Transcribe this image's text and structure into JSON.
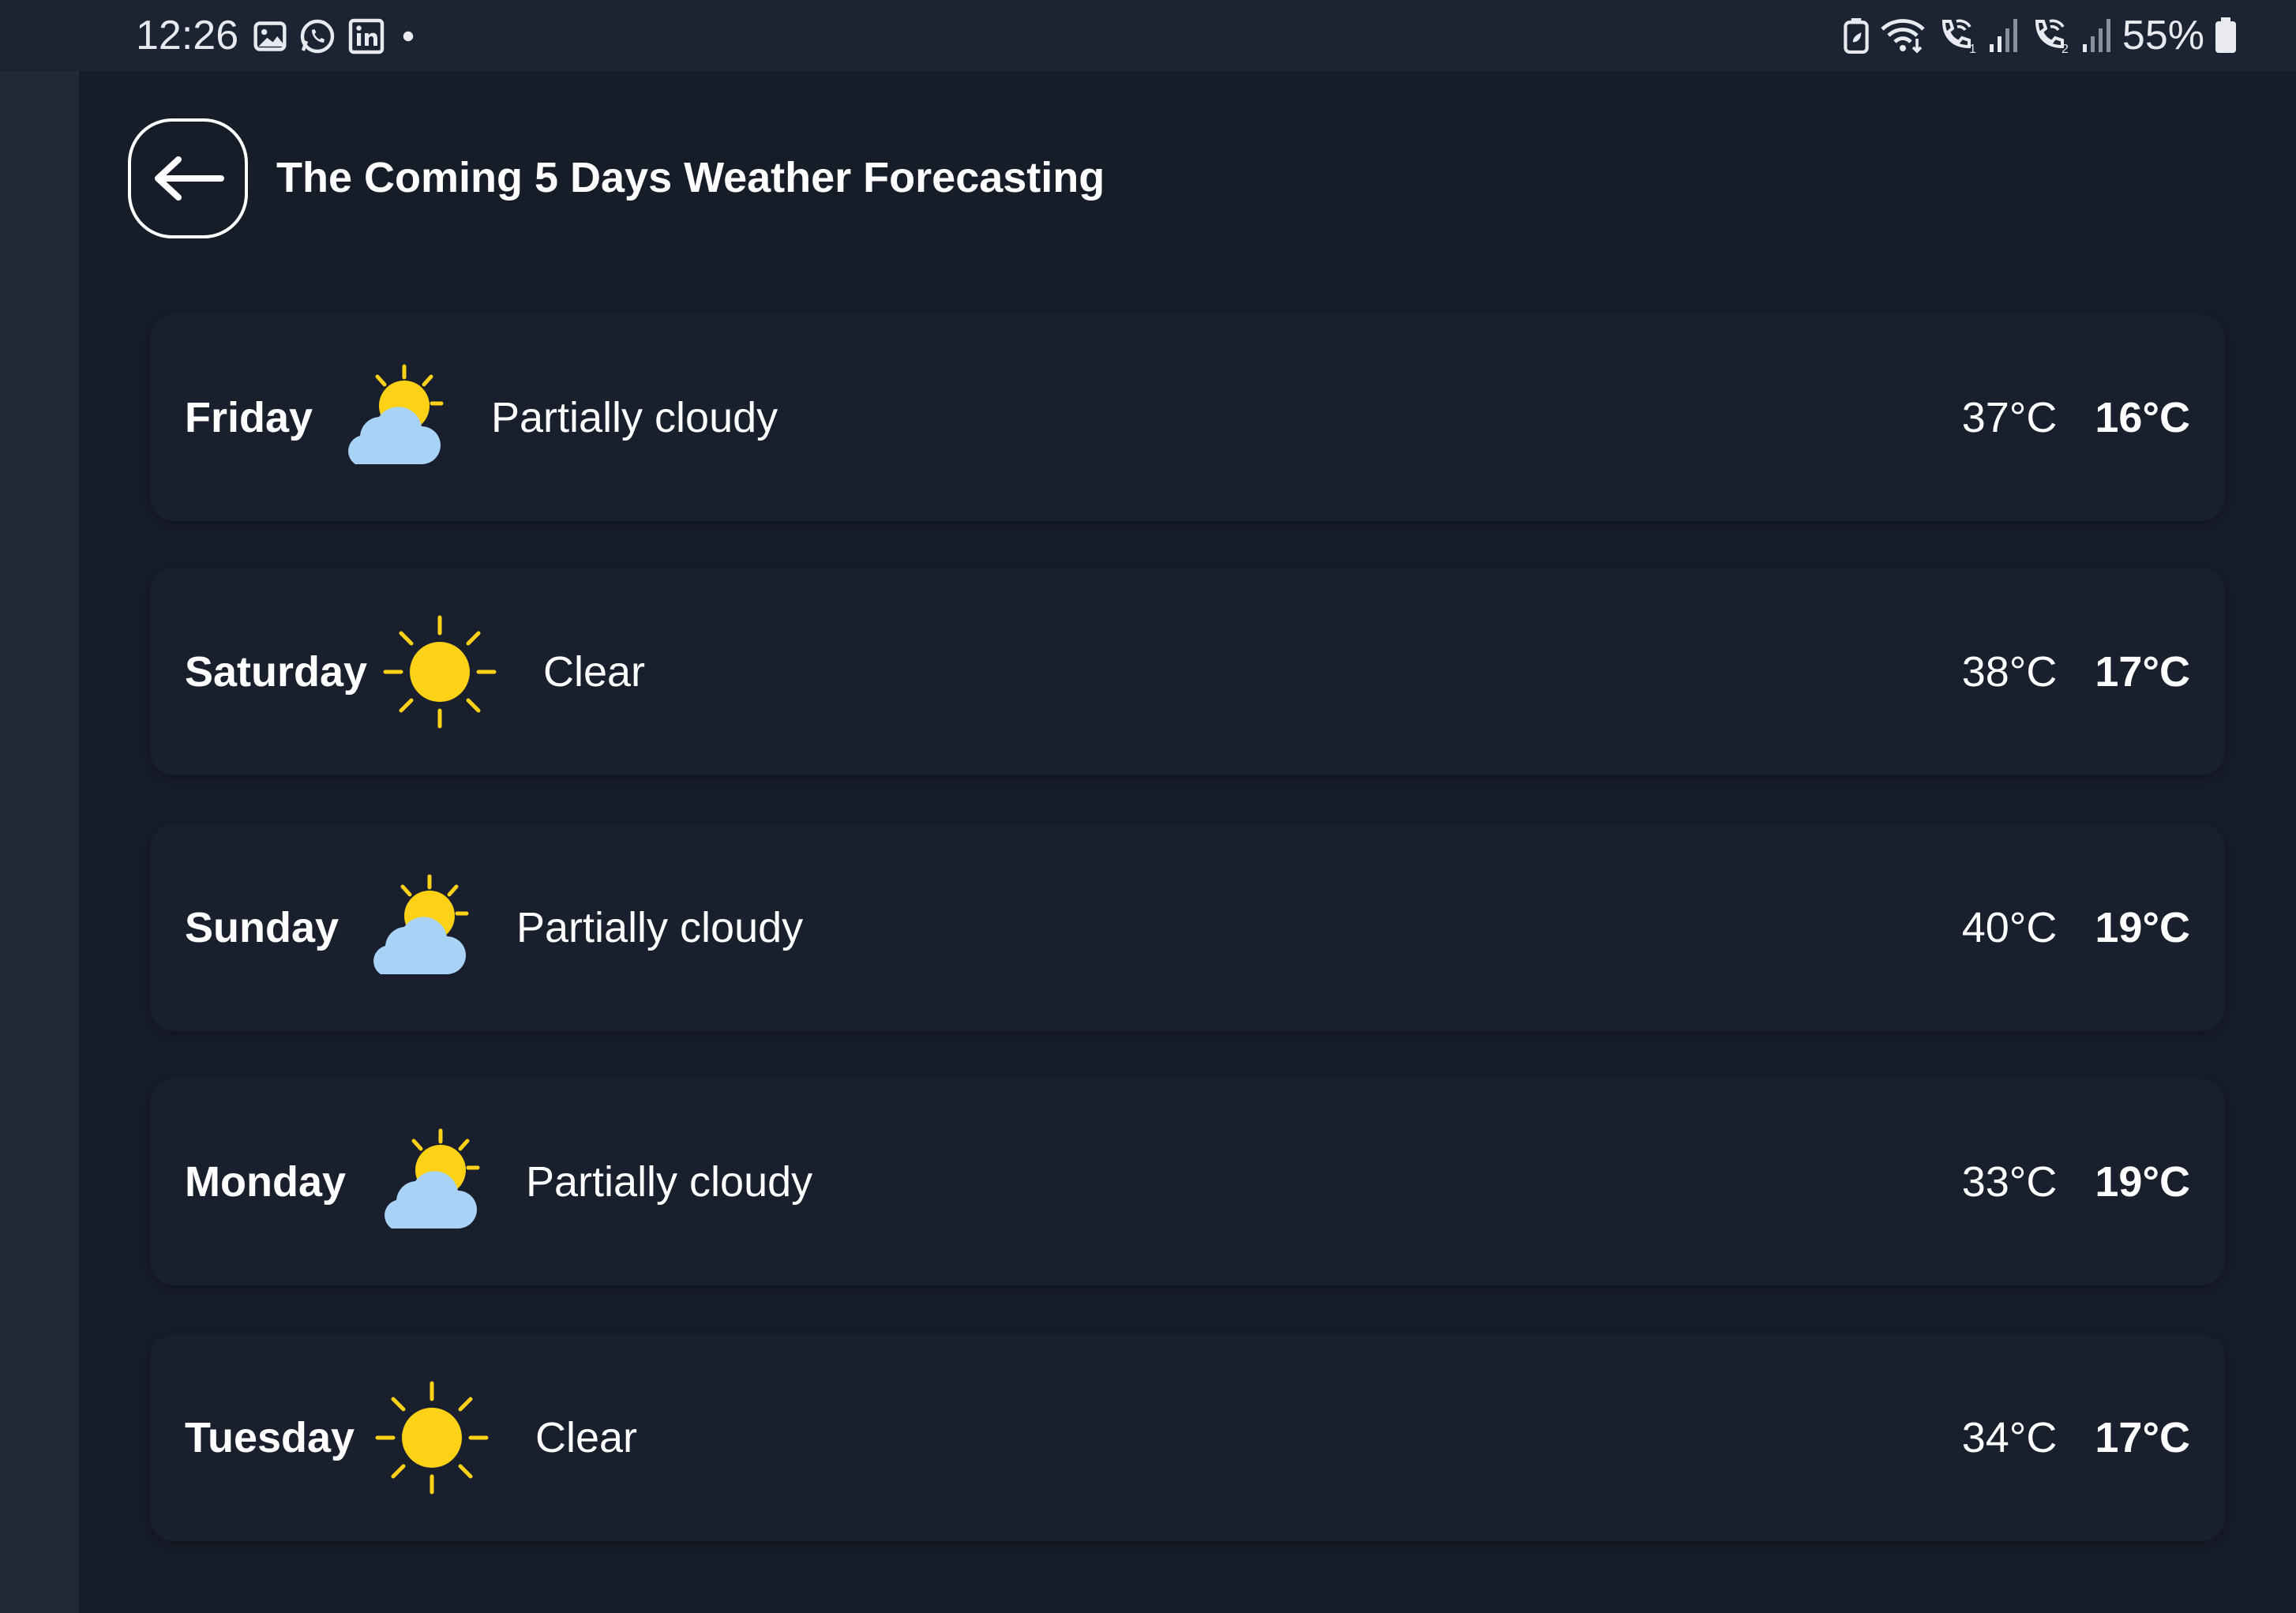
{
  "status_bar": {
    "time": "12:26",
    "battery": "55%",
    "left_icons": [
      "gallery-icon",
      "whatsapp-icon",
      "linkedin-icon",
      "dot-icon"
    ],
    "right_icons": [
      "battery-saver-icon",
      "wifi-icon",
      "wifi-call-1-icon",
      "signal-1-icon",
      "wifi-call-2-icon",
      "signal-2-icon",
      "battery-icon"
    ]
  },
  "header": {
    "title": "The Coming 5 Days Weather Forecasting",
    "back_icon": "arrow-left-icon"
  },
  "colors": {
    "background": "#171c29",
    "card": "#191f2d",
    "sun": "#fcd116",
    "cloud": "#a8d2f6",
    "text": "#ffffff"
  },
  "forecast": [
    {
      "day": "Friday",
      "icon": "partly-cloudy-icon",
      "condition": "Partially cloudy",
      "high": "37°C",
      "low": "16°C"
    },
    {
      "day": "Saturday",
      "icon": "sun-icon",
      "condition": "Clear",
      "high": "38°C",
      "low": "17°C"
    },
    {
      "day": "Sunday",
      "icon": "partly-cloudy-icon",
      "condition": "Partially cloudy",
      "high": "40°C",
      "low": "19°C"
    },
    {
      "day": "Monday",
      "icon": "partly-cloudy-icon",
      "condition": "Partially cloudy",
      "high": "33°C",
      "low": "19°C"
    },
    {
      "day": "Tuesday",
      "icon": "sun-icon",
      "condition": "Clear",
      "high": "34°C",
      "low": "17°C"
    }
  ]
}
